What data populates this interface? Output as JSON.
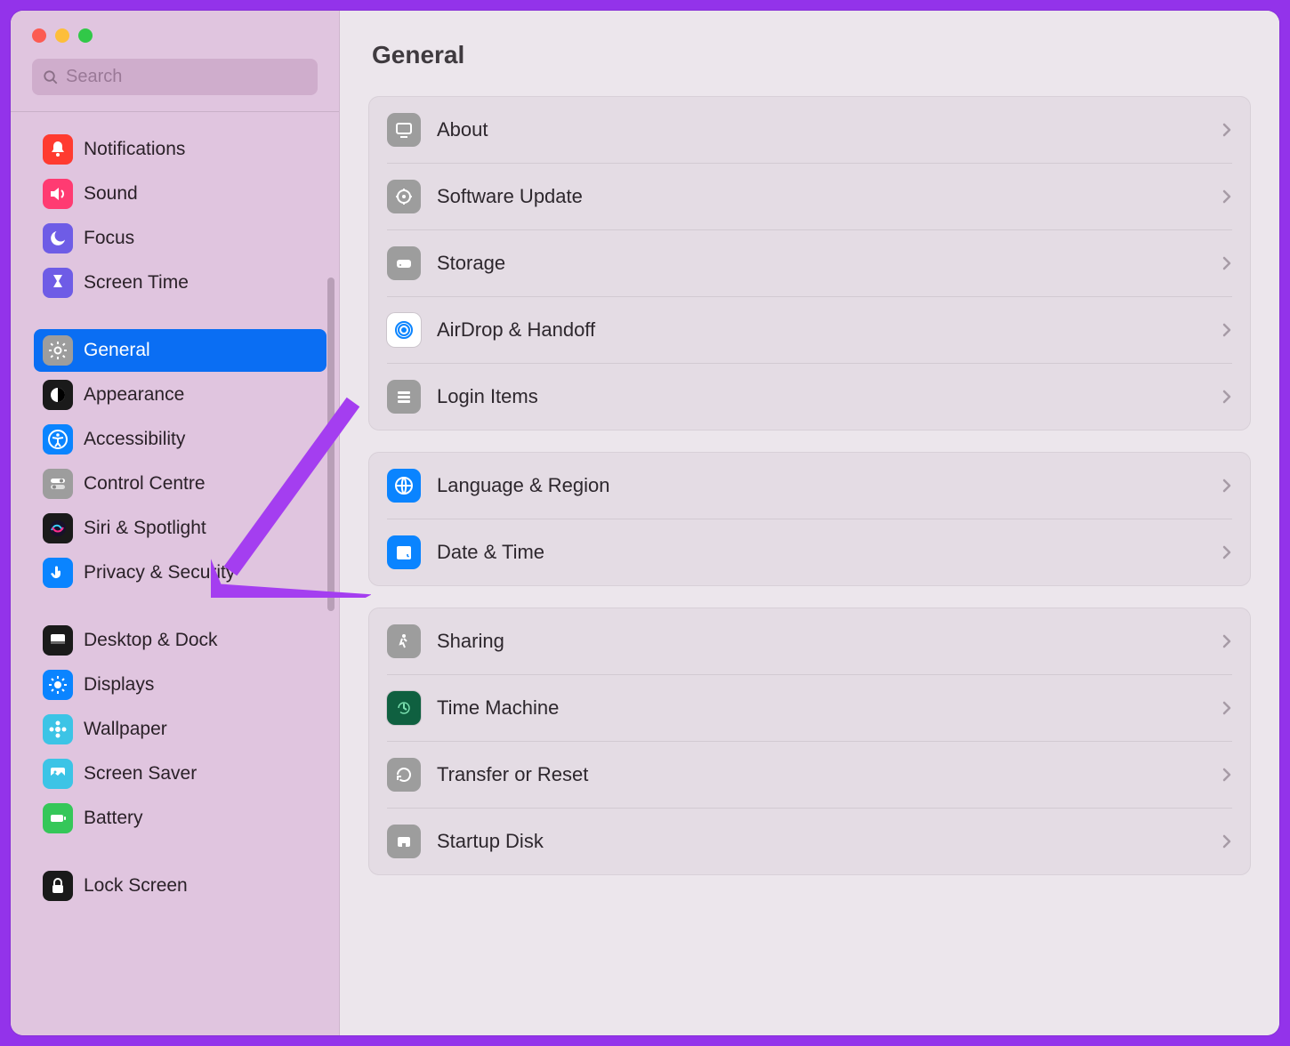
{
  "search": {
    "placeholder": "Search"
  },
  "title": "General",
  "sidebar": {
    "groups": [
      {
        "items": [
          {
            "label": "Notifications",
            "icon": "bell-icon",
            "bg": "#ff3b30"
          },
          {
            "label": "Sound",
            "icon": "speaker-icon",
            "bg": "#ff3b72"
          },
          {
            "label": "Focus",
            "icon": "moon-icon",
            "bg": "#6e5ce6"
          },
          {
            "label": "Screen Time",
            "icon": "hourglass-icon",
            "bg": "#6e5ce6"
          }
        ]
      },
      {
        "items": [
          {
            "label": "General",
            "icon": "gear-icon",
            "bg": "#9d9d9d",
            "active": true
          },
          {
            "label": "Appearance",
            "icon": "appearance-icon",
            "bg": "#1a1a1a"
          },
          {
            "label": "Accessibility",
            "icon": "accessibility-icon",
            "bg": "#0a84ff"
          },
          {
            "label": "Control Centre",
            "icon": "toggles-icon",
            "bg": "#9d9d9d"
          },
          {
            "label": "Siri & Spotlight",
            "icon": "siri-icon",
            "bg": "#1a1a1a"
          },
          {
            "label": "Privacy & Security",
            "icon": "hand-icon",
            "bg": "#0a84ff"
          }
        ]
      },
      {
        "items": [
          {
            "label": "Desktop & Dock",
            "icon": "dock-icon",
            "bg": "#1a1a1a"
          },
          {
            "label": "Displays",
            "icon": "brightness-icon",
            "bg": "#0a84ff"
          },
          {
            "label": "Wallpaper",
            "icon": "flower-icon",
            "bg": "#3cc4e6"
          },
          {
            "label": "Screen Saver",
            "icon": "screensaver-icon",
            "bg": "#3cc4e6"
          },
          {
            "label": "Battery",
            "icon": "battery-icon",
            "bg": "#35c759"
          }
        ]
      },
      {
        "items": [
          {
            "label": "Lock Screen",
            "icon": "lock-icon",
            "bg": "#1a1a1a"
          }
        ]
      }
    ]
  },
  "panels": [
    {
      "rows": [
        {
          "label": "About",
          "icon": "display-icon",
          "bg": "#9d9d9d"
        },
        {
          "label": "Software Update",
          "icon": "update-gear-icon",
          "bg": "#9d9d9d"
        },
        {
          "label": "Storage",
          "icon": "storage-icon",
          "bg": "#9d9d9d"
        },
        {
          "label": "AirDrop & Handoff",
          "icon": "airdrop-icon",
          "bg": "#ffffff",
          "fg": "#0a84ff",
          "border": true
        },
        {
          "label": "Login Items",
          "icon": "list-icon",
          "bg": "#9d9d9d"
        }
      ]
    },
    {
      "rows": [
        {
          "label": "Language & Region",
          "icon": "globe-icon",
          "bg": "#0a84ff"
        },
        {
          "label": "Date & Time",
          "icon": "calendar-clock-icon",
          "bg": "#0a84ff"
        }
      ]
    },
    {
      "rows": [
        {
          "label": "Sharing",
          "icon": "walking-icon",
          "bg": "#9d9d9d"
        },
        {
          "label": "Time Machine",
          "icon": "timemachine-icon",
          "bg": "#0f6040",
          "border": true
        },
        {
          "label": "Transfer or Reset",
          "icon": "reset-icon",
          "bg": "#9d9d9d"
        },
        {
          "label": "Startup Disk",
          "icon": "disk-icon",
          "bg": "#9d9d9d"
        }
      ]
    }
  ],
  "annotation": {
    "color": "#a43ef0"
  }
}
